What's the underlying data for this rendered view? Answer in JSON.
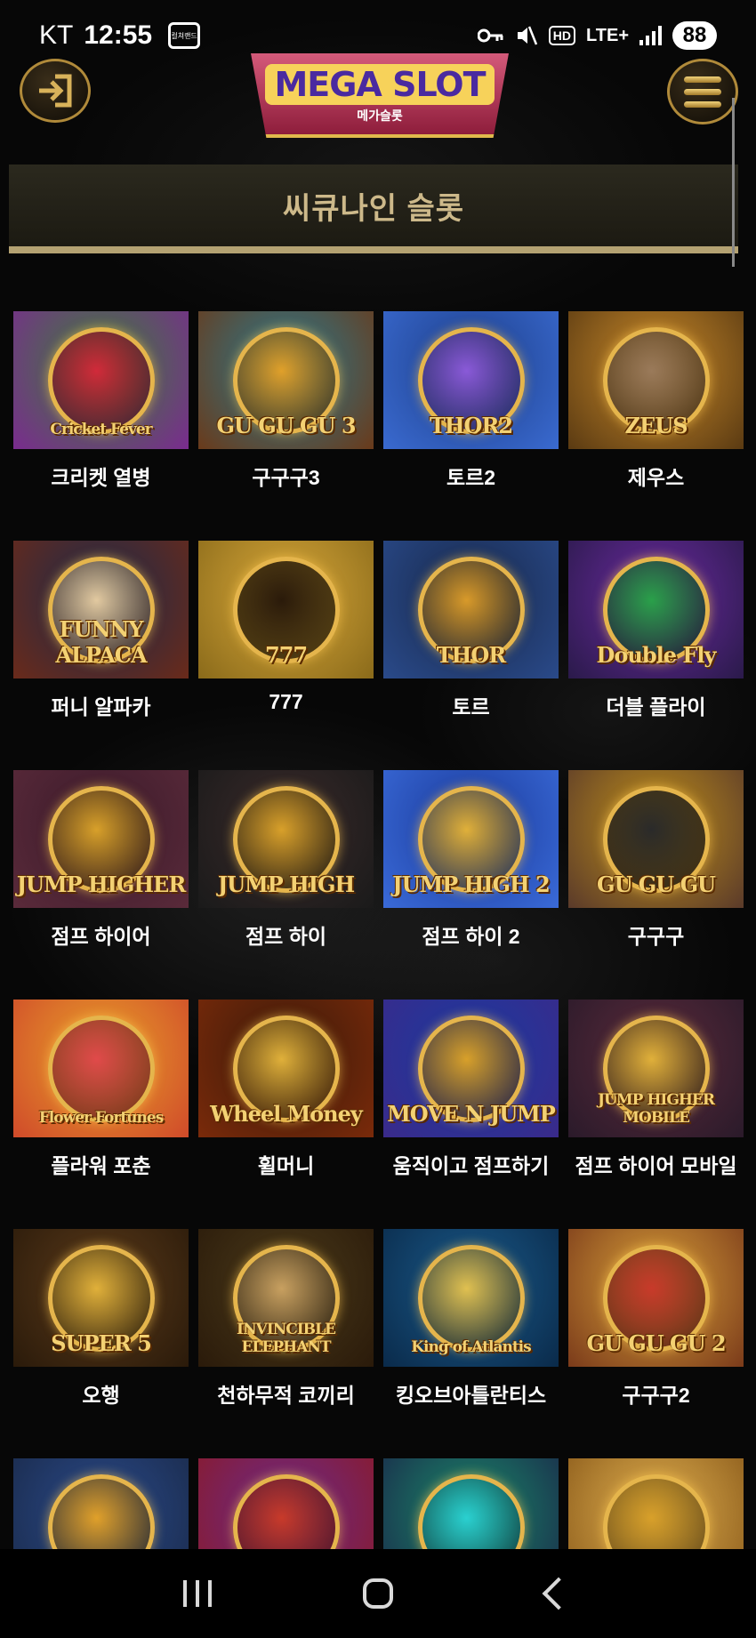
{
  "status_bar": {
    "carrier": "KT",
    "time": "12:55",
    "app_icon_label": "컬쳐랜드",
    "hd": "HD",
    "lte": "LTE+",
    "battery": "88"
  },
  "header": {
    "logo_main": "MEGA SLOT",
    "logo_sub": "메가슬롯"
  },
  "category": {
    "title": "씨큐나인 슬롯"
  },
  "games": [
    {
      "name": "크리켓 열병",
      "logo": "Cricket Fever",
      "c1": "#3d7d3a",
      "c2": "#7a2b8f",
      "ring": "#d12a3a"
    },
    {
      "name": "구구구3",
      "logo": "GU GU GU 3",
      "c1": "#2a7a8f",
      "c2": "#6a3a1a",
      "ring": "#e0a02a"
    },
    {
      "name": "토르2",
      "logo": "THOR2",
      "c1": "#1d3f8a",
      "c2": "#3a6ad0",
      "ring": "#8a5ad8"
    },
    {
      "name": "제우스",
      "logo": "ZEUS",
      "c1": "#c98a2a",
      "c2": "#5a3a12",
      "ring": "#9a7a5a"
    },
    {
      "name": "퍼니 알파카",
      "logo": "FUNNY ALPACA",
      "c1": "#1c2a4a",
      "c2": "#6a2a1a",
      "ring": "#e2c9a0"
    },
    {
      "name": "777",
      "logo": "777",
      "c1": "#d8a83a",
      "c2": "#8a6a1a",
      "ring": "#2a1a0a"
    },
    {
      "name": "토르",
      "logo": "THOR",
      "c1": "#17284a",
      "c2": "#2a4a8a",
      "ring": "#d89a2a"
    },
    {
      "name": "더블 플라이",
      "logo": "Double Fly",
      "c1": "#6a2aa0",
      "c2": "#2a1a4a",
      "ring": "#2aa04a"
    },
    {
      "name": "점프 하이어",
      "logo": "JUMP HIGHER",
      "c1": "#3a1a2a",
      "c2": "#5a2a3a",
      "ring": "#d8a02a"
    },
    {
      "name": "점프 하이",
      "logo": "JUMP HIGH",
      "c1": "#3a2a2a",
      "c2": "#1a1a1a",
      "ring": "#d8a02a"
    },
    {
      "name": "점프 하이 2",
      "logo": "JUMP HIGH 2",
      "c1": "#1a3a9a",
      "c2": "#3a6ad8",
      "ring": "#e0b03a"
    },
    {
      "name": "구구구",
      "logo": "GU GU GU",
      "c1": "#c0901a",
      "c2": "#5a3a2a",
      "ring": "#2a2a2a"
    },
    {
      "name": "플라워 포춘",
      "logo": "Flower Fortunes",
      "c1": "#e8a02a",
      "c2": "#d04a2a",
      "ring": "#e04a4a"
    },
    {
      "name": "휠머니",
      "logo": "Wheel Money",
      "c1": "#3a1a0a",
      "c2": "#7a2a0a",
      "ring": "#e0b03a"
    },
    {
      "name": "움직이고 점프하기",
      "logo": "MOVE N JUMP",
      "c1": "#1a3aa0",
      "c2": "#3a2a8a",
      "ring": "#d8a02a"
    },
    {
      "name": "점프 하이어 모바일",
      "logo": "JUMP HIGHER MOBILE",
      "c1": "#5a2a3a",
      "c2": "#2a1a2a",
      "ring": "#e0b03a"
    },
    {
      "name": "오행",
      "logo": "SUPER 5",
      "c1": "#5a3a1a",
      "c2": "#2a1a0a",
      "ring": "#e0b03a"
    },
    {
      "name": "천하무적 코끼리",
      "logo": "INVINCIBLE ELEPHANT",
      "c1": "#4a3a1a",
      "c2": "#2a1a0a",
      "ring": "#c8a060"
    },
    {
      "name": "킹오브아틀란티스",
      "logo": "King of Atlantis",
      "c1": "#1a5a8a",
      "c2": "#0a2a4a",
      "ring": "#e0c050"
    },
    {
      "name": "구구구2",
      "logo": "GU GU GU 2",
      "c1": "#d8a03a",
      "c2": "#7a3a1a",
      "ring": "#c83a2a"
    },
    {
      "name": "",
      "logo": "",
      "c1": "#2a4a8a",
      "c2": "#1a2a4a",
      "ring": "#e0a02a"
    },
    {
      "name": "",
      "logo": "",
      "c1": "#6a2a8a",
      "c2": "#8a1a2a",
      "ring": "#c83a2a"
    },
    {
      "name": "",
      "logo": "",
      "c1": "#1a8a6a",
      "c2": "#1a2a4a",
      "ring": "#2ad0d0"
    },
    {
      "name": "",
      "logo": "",
      "c1": "#e0b050",
      "c2": "#8a5a1a",
      "ring": "#d8a02a"
    }
  ]
}
